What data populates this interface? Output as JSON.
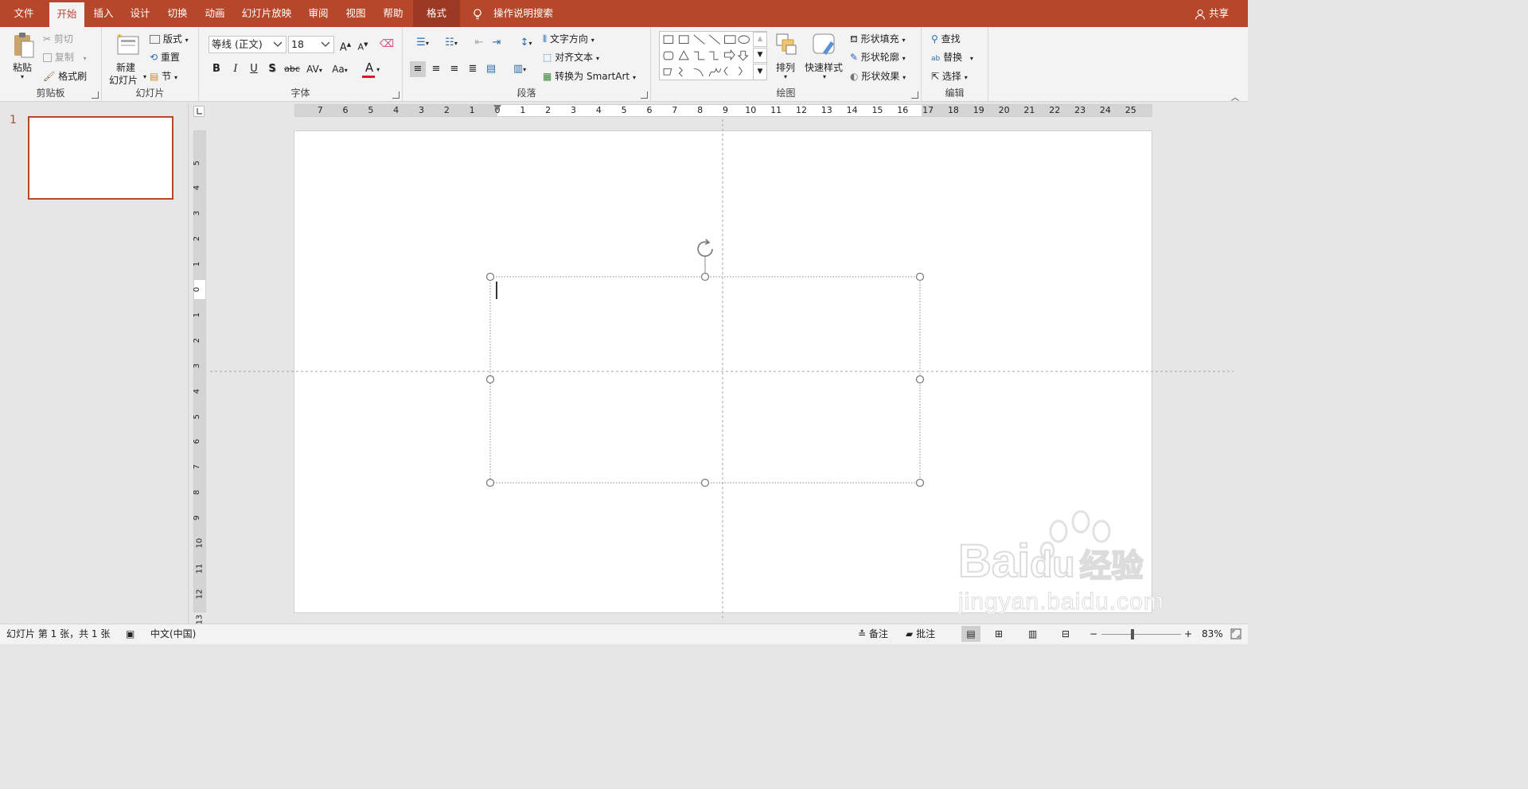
{
  "tabs": [
    {
      "label": "文件"
    },
    {
      "label": "开始"
    },
    {
      "label": "插入"
    },
    {
      "label": "设计"
    },
    {
      "label": "切换"
    },
    {
      "label": "动画"
    },
    {
      "label": "幻灯片放映"
    },
    {
      "label": "审阅"
    },
    {
      "label": "视图"
    },
    {
      "label": "帮助"
    },
    {
      "label": "格式"
    }
  ],
  "tell_me": "操作说明搜索",
  "share": "共享",
  "clipboard": {
    "paste": "粘贴",
    "cut": "剪切",
    "copy": "复制",
    "format_painter": "格式刷",
    "label": "剪贴板"
  },
  "slides_group": {
    "new_slide_1": "新建",
    "new_slide_2": "幻灯片",
    "layout": "版式",
    "reset": "重置",
    "section": "节",
    "label": "幻灯片"
  },
  "font": {
    "name": "等线 (正文)",
    "size": "18",
    "bold": "B",
    "italic": "I",
    "underline": "U",
    "shadow": "S",
    "strike": "abc",
    "spacing": "AV",
    "case": "Aa",
    "color": "A",
    "grow": "A",
    "shrink": "A",
    "label": "字体",
    "accent": "#e81123"
  },
  "paragraph": {
    "text_direction": "文字方向",
    "align_text": "对齐文本",
    "smartart": "转换为 SmartArt",
    "label": "段落"
  },
  "drawing": {
    "arrange": "排列",
    "quick_styles": "快速样式",
    "fill": "形状填充",
    "outline": "形状轮廓",
    "effects": "形状效果",
    "label": "绘图"
  },
  "editing": {
    "find": "查找",
    "replace": "替换",
    "select": "选择",
    "label": "编辑"
  },
  "ruler": {
    "h": [
      "7",
      "6",
      "5",
      "4",
      "3",
      "2",
      "1",
      "0",
      "1",
      "2",
      "3",
      "4",
      "5",
      "6",
      "7",
      "8",
      "9",
      "10",
      "11",
      "12",
      "13",
      "14",
      "15",
      "16",
      "17",
      "18",
      "19",
      "20",
      "21",
      "22",
      "23",
      "24",
      "25"
    ],
    "v": [
      "5",
      "4",
      "3",
      "2",
      "1",
      "0",
      "1",
      "2",
      "3",
      "4",
      "5",
      "6",
      "7",
      "8",
      "9",
      "10",
      "11",
      "12",
      "13"
    ]
  },
  "thumbnail": {
    "number": "1"
  },
  "status": {
    "slide_info": "幻灯片 第 1 张，共 1 张",
    "language": "中文(中国)",
    "notes": "备注",
    "comments": "批注",
    "zoom": "83%"
  },
  "watermark": {
    "brand": "Bai",
    "brand2": "du",
    "cn": "经验",
    "url": "jingyan.baidu.com"
  },
  "colors": {
    "accent": "#b7472a",
    "ribbon": "#f3f3f3"
  }
}
